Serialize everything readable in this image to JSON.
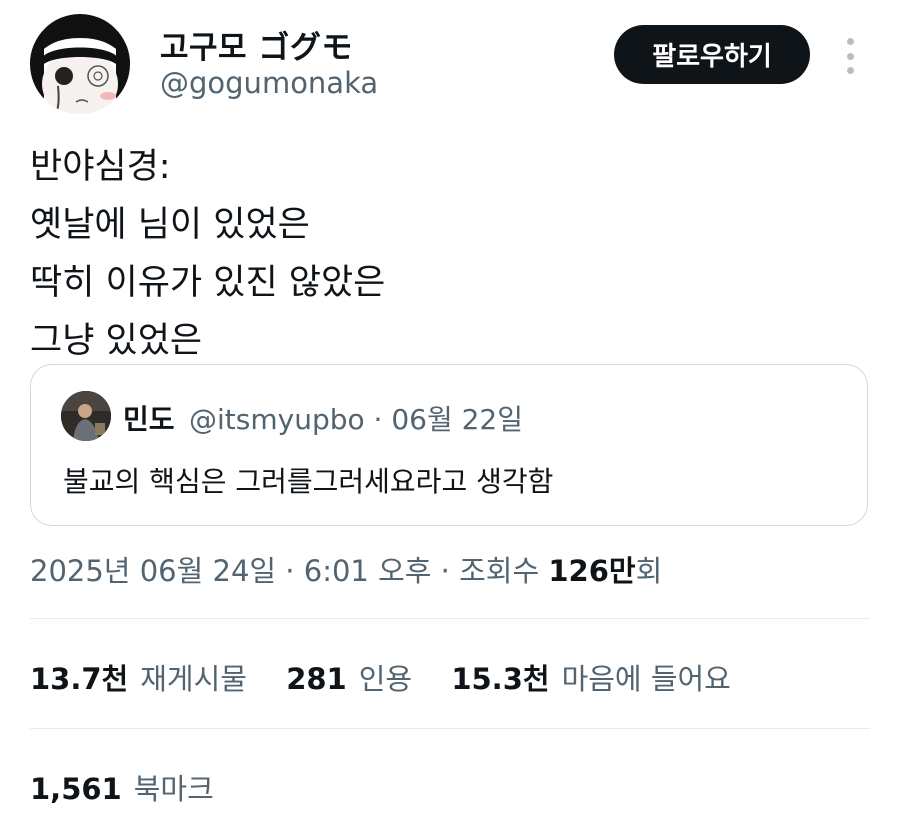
{
  "author": {
    "display_name": "고구모 ゴグモ",
    "handle": "@gogumonaka"
  },
  "follow_label": "팔로우하기",
  "more_icon": "more-vertical-icon",
  "tweet": {
    "lines": [
      "반야심경:",
      "옛날에 님이 있었은",
      "딱히 이유가 있진 않았은",
      "그냥 있었은"
    ]
  },
  "quote": {
    "name": "민도",
    "meta": "@itsmyupbo · 06월 22일",
    "text": "불교의 핵심은 그러를그러세요라고 생각함"
  },
  "timestamp": {
    "prefix": "2025년 06월 24일 · 6:01 오후 · 조회수 ",
    "views": "126만",
    "suffix": "회"
  },
  "stats": {
    "reposts_count": "13.7천",
    "reposts_label": "재게시물",
    "quotes_count": "281",
    "quotes_label": "인용",
    "likes_count": "15.3천",
    "likes_label": "마음에 들어요"
  },
  "bookmarks": {
    "count": "1,561",
    "label": "북마크"
  },
  "colors": {
    "text": "#0f1419",
    "secondary": "#536471",
    "border": "#cfd9de",
    "button_bg": "#0f1419"
  }
}
